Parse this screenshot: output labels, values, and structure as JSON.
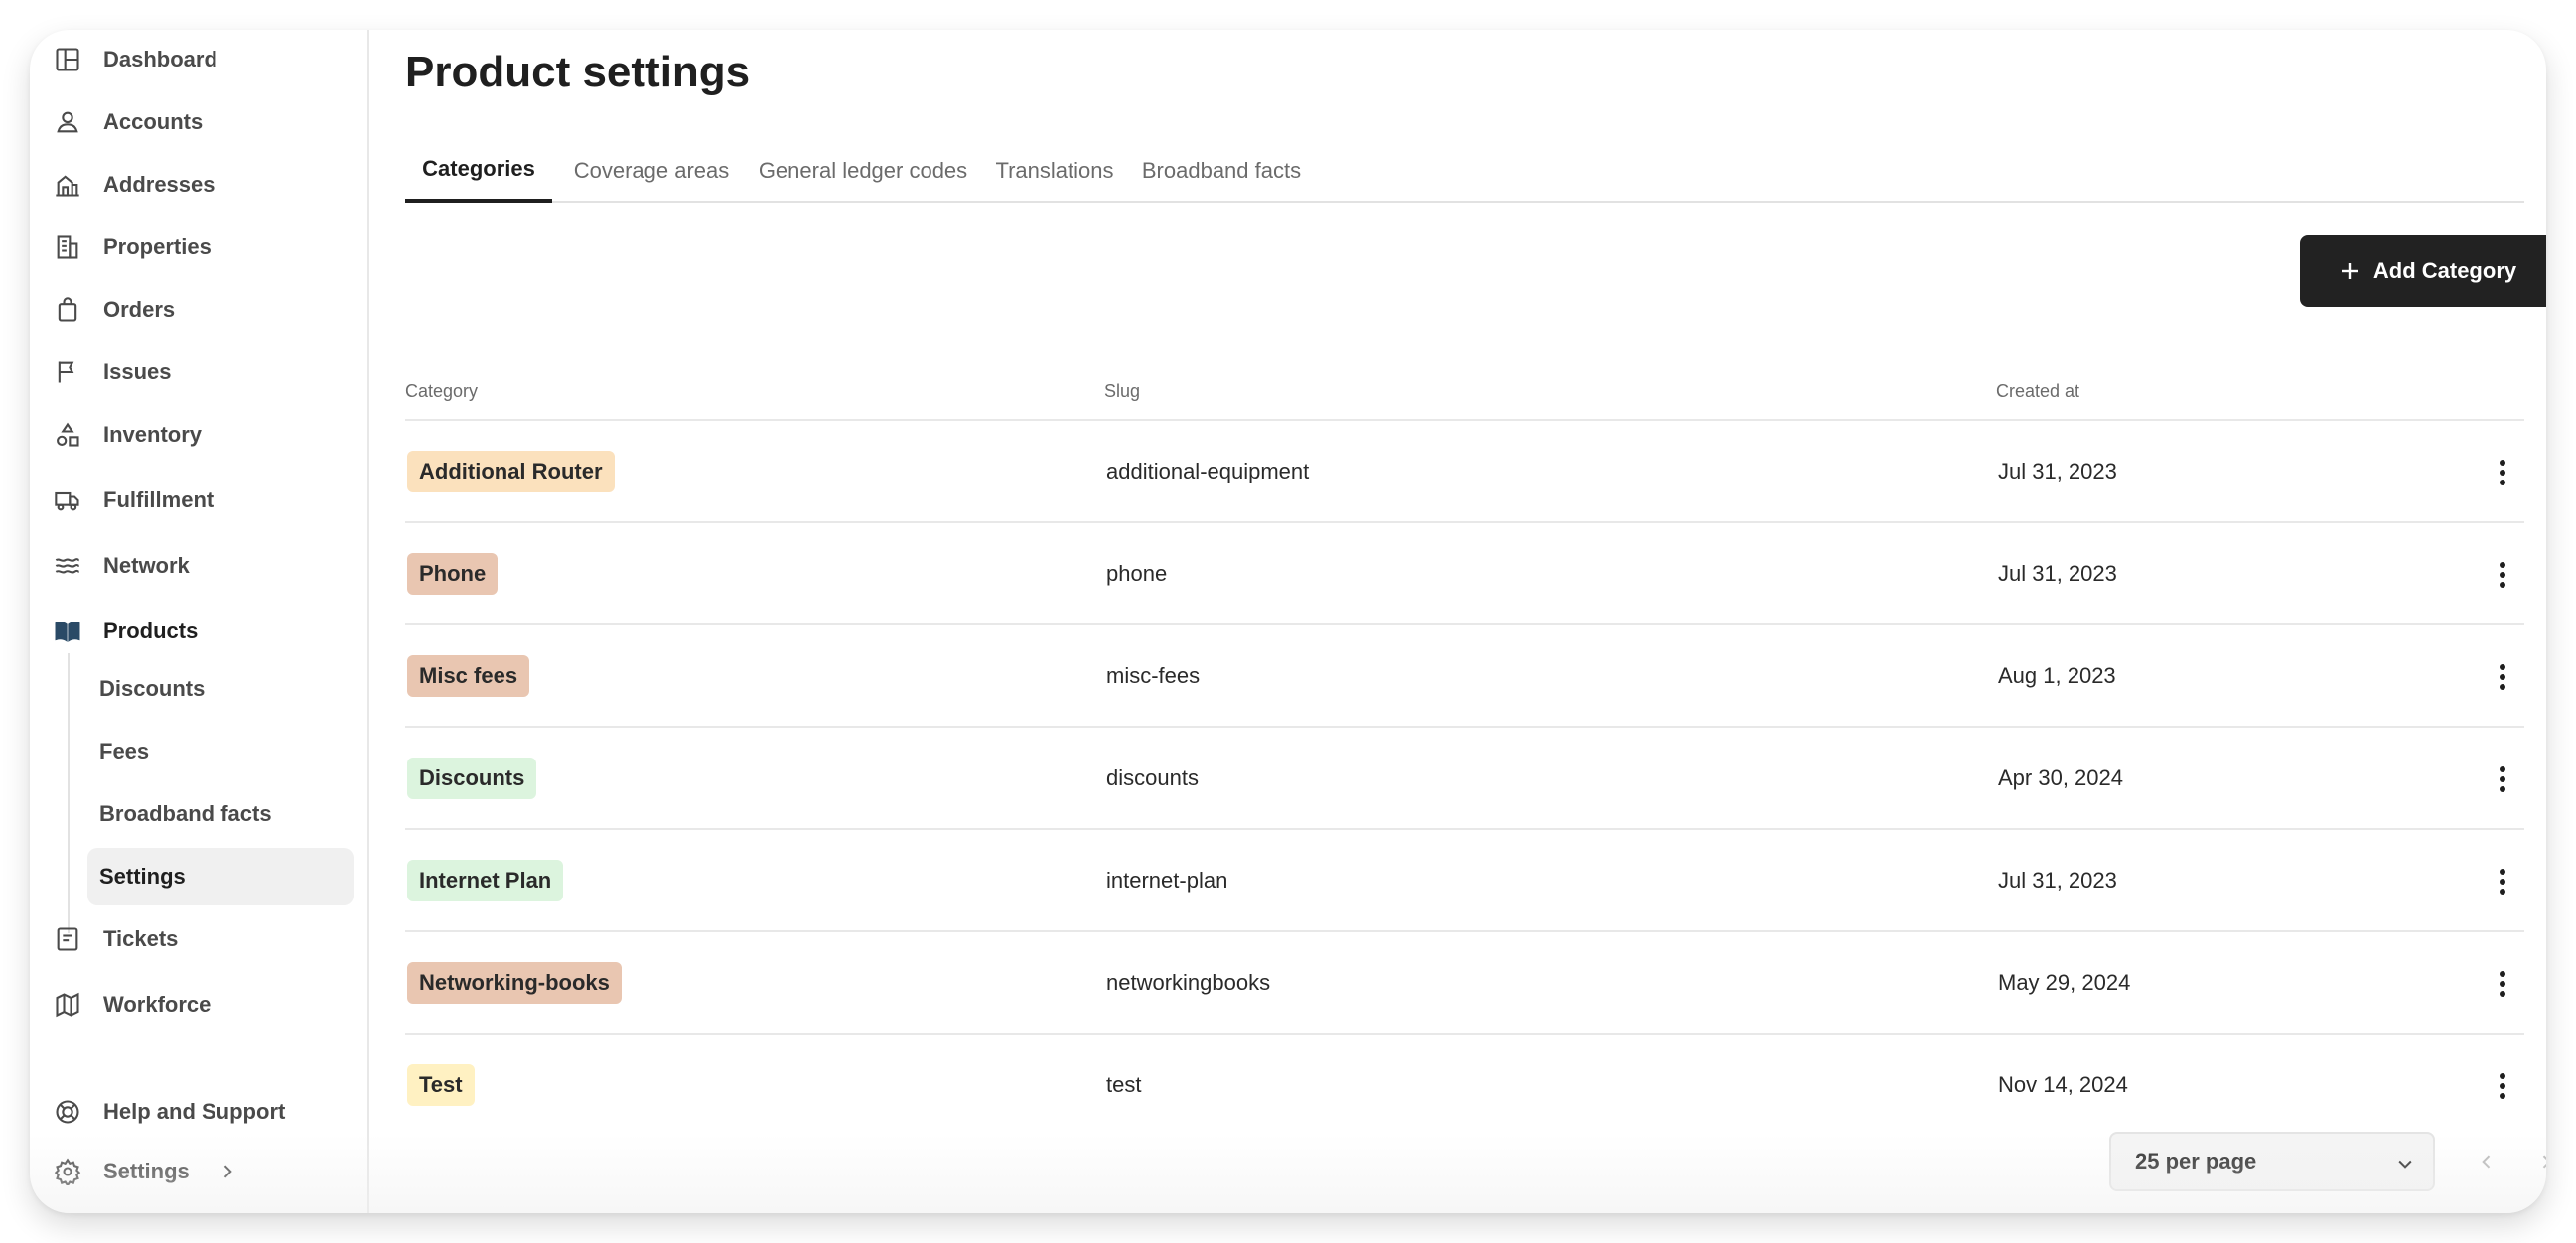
{
  "sidebar": {
    "items": [
      {
        "label": "Dashboard",
        "icon": "layout-icon"
      },
      {
        "label": "Accounts",
        "icon": "user-icon"
      },
      {
        "label": "Addresses",
        "icon": "house-icon"
      },
      {
        "label": "Properties",
        "icon": "building-icon"
      },
      {
        "label": "Orders",
        "icon": "bag-icon"
      },
      {
        "label": "Issues",
        "icon": "flag-icon"
      },
      {
        "label": "Inventory",
        "icon": "shapes-icon"
      },
      {
        "label": "Fulfillment",
        "icon": "truck-icon"
      },
      {
        "label": "Network",
        "icon": "waves-icon"
      },
      {
        "label": "Products",
        "icon": "book-open-icon"
      },
      {
        "label": "Tickets",
        "icon": "ticket-icon"
      },
      {
        "label": "Workforce",
        "icon": "map-icon"
      }
    ],
    "products_sub": [
      {
        "label": "Discounts"
      },
      {
        "label": "Fees"
      },
      {
        "label": "Broadband facts"
      },
      {
        "label": "Settings"
      }
    ],
    "footer": {
      "help_label": "Help and Support",
      "settings_label": "Settings"
    }
  },
  "main": {
    "title": "Product settings",
    "tabs": [
      {
        "label": "Categories"
      },
      {
        "label": "Coverage areas"
      },
      {
        "label": "General ledger codes"
      },
      {
        "label": "Translations"
      },
      {
        "label": "Broadband facts"
      }
    ],
    "add_button_label": "Add Category",
    "table": {
      "columns": [
        "Category",
        "Slug",
        "Created at"
      ],
      "rows": [
        {
          "category": "Additional Router",
          "slug": "additional-equipment",
          "created": "Jul 31, 2023",
          "color": "#fbe1bd"
        },
        {
          "category": "Phone",
          "slug": "phone",
          "created": "Jul 31, 2023",
          "color": "#e9c6b1"
        },
        {
          "category": "Misc fees",
          "slug": "misc-fees",
          "created": "Aug 1, 2023",
          "color": "#e9c6b1"
        },
        {
          "category": "Discounts",
          "slug": "discounts",
          "created": "Apr 30, 2024",
          "color": "#dcf4de"
        },
        {
          "category": "Internet Plan",
          "slug": "internet-plan",
          "created": "Jul 31, 2023",
          "color": "#dcf4de"
        },
        {
          "category": "Networking-books",
          "slug": "networkingbooks",
          "created": "May 29, 2024",
          "color": "#e9c6b1"
        },
        {
          "category": "Test",
          "slug": "test",
          "created": "Nov 14, 2024",
          "color": "#fff1c2"
        }
      ]
    },
    "pagination": {
      "per_page": "25 per page"
    }
  }
}
